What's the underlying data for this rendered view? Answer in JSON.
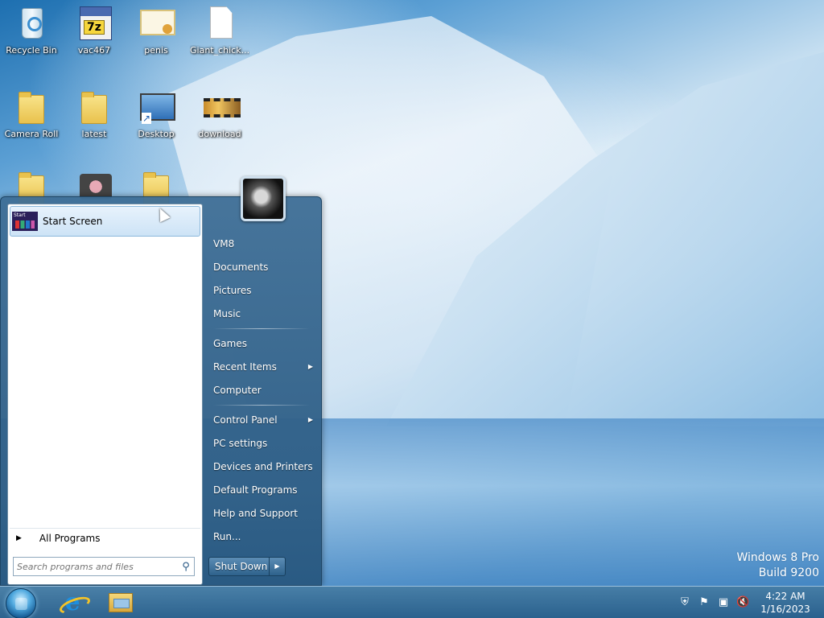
{
  "desktop": {
    "icons": [
      {
        "label": "Recycle Bin"
      },
      {
        "label": "vac467"
      },
      {
        "label": "penis"
      },
      {
        "label": "Giant_chick..."
      },
      {
        "label": "Camera Roll"
      },
      {
        "label": "latest"
      },
      {
        "label": "Desktop"
      },
      {
        "label": "download"
      }
    ],
    "watermark": {
      "line1": "Windows 8 Pro",
      "line2": "Build 9200"
    }
  },
  "start_menu": {
    "pinned": [
      {
        "label": "Start Screen",
        "icon": "start-screen-tile-icon"
      }
    ],
    "all_programs_label": "All Programs",
    "search": {
      "placeholder": "Search programs and files",
      "value": ""
    },
    "right_items": [
      {
        "label": "VM8",
        "has_submenu": false
      },
      {
        "label": "Documents",
        "has_submenu": false
      },
      {
        "label": "Pictures",
        "has_submenu": false
      },
      {
        "label": "Music",
        "has_submenu": false
      },
      {
        "label": "Games",
        "has_submenu": false
      },
      {
        "label": "Recent Items",
        "has_submenu": true
      },
      {
        "label": "Computer",
        "has_submenu": false
      },
      {
        "label": "Control Panel",
        "has_submenu": true
      },
      {
        "label": "PC settings",
        "has_submenu": false
      },
      {
        "label": "Devices and Printers",
        "has_submenu": false
      },
      {
        "label": "Default Programs",
        "has_submenu": false
      },
      {
        "label": "Help and Support",
        "has_submenu": false
      },
      {
        "label": "Run...",
        "has_submenu": false
      }
    ],
    "shutdown_label": "Shut Down",
    "submenu_glyph": "▶",
    "all_programs_glyph": "▶"
  },
  "taskbar": {
    "apps": [
      {
        "icon": "internet-explorer-icon"
      },
      {
        "icon": "file-explorer-icon"
      }
    ],
    "tray": {
      "icons": [
        "action-center-icon",
        "flag-icon",
        "network-icon",
        "volume-muted-icon"
      ],
      "time": "4:22 AM",
      "date": "1/16/2023"
    }
  }
}
